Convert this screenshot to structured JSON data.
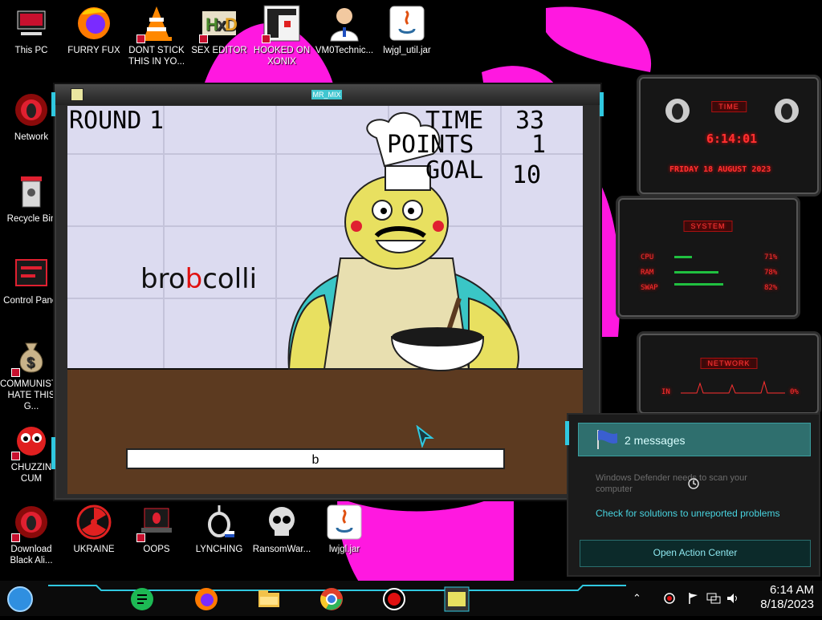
{
  "desktop": {
    "icons_top": [
      {
        "label": "This PC",
        "icon": "this-pc-icon"
      },
      {
        "label": "FURRY FUX",
        "icon": "firefox-icon"
      },
      {
        "label": "DONT STICK THIS IN YO...",
        "icon": "vlc-cone-icon"
      },
      {
        "label": "SEX EDITOR",
        "icon": "hxd-editor-icon"
      },
      {
        "label": "HOOKED ON XONIX",
        "icon": "xonix-game-icon"
      },
      {
        "label": "VM0Technic...",
        "icon": "doctor-avatar-icon"
      },
      {
        "label": "lwjgl_util.jar",
        "icon": "java-jar-icon"
      }
    ],
    "icons_left": [
      {
        "label": "Network",
        "icon": "network-alien-icon"
      },
      {
        "label": "Recycle Bin",
        "icon": "recycle-bin-icon"
      },
      {
        "label": "Control Panel",
        "icon": "control-panel-icon"
      },
      {
        "label": "COMMUNISTS HATE THIS G...",
        "icon": "money-bag-icon"
      },
      {
        "label": "CHUZZIN CUM",
        "icon": "chuzzle-icon"
      }
    ],
    "icons_bottom": [
      {
        "label": "Download Black Ali...",
        "icon": "alien-download-icon"
      },
      {
        "label": "UKRAINE",
        "icon": "radiation-icon"
      },
      {
        "label": "OOPS",
        "icon": "laptop-alien-icon"
      },
      {
        "label": "LYNCHING",
        "icon": "noose-icon"
      },
      {
        "label": "RansomWar...",
        "icon": "skull-icon"
      },
      {
        "label": "lwjgl.jar",
        "icon": "java-jar-icon"
      }
    ]
  },
  "game_window": {
    "title": "MR_MIX",
    "hud": {
      "round_label": "ROUND",
      "round_value": "1",
      "time_label": "TIME",
      "time_value": "33",
      "points_label": "POINTS",
      "points_value": "1",
      "goal_label": "GOAL",
      "goal_value": "10"
    },
    "word": {
      "typed": "bro",
      "cursor": "b",
      "rest": "colli"
    },
    "input_value": "b"
  },
  "gadgets": {
    "time": {
      "title": "TIME",
      "clock": "6:14:01",
      "date": "FRIDAY 18 AUGUST 2023"
    },
    "system": {
      "title": "SYSTEM",
      "rows": [
        {
          "label": "CPU",
          "value": "71%",
          "fraction": 0.2
        },
        {
          "label": "RAM",
          "value": "78%",
          "fraction": 0.5
        },
        {
          "label": "SWAP",
          "value": "82%",
          "fraction": 0.55
        }
      ]
    },
    "network": {
      "title": "NETWORK",
      "in_label": "IN",
      "in_value": "0%"
    }
  },
  "action_center": {
    "message_count": "2 messages",
    "faded_text": "Windows Defender needs to scan your computer",
    "link_text": "Check for solutions to unreported problems",
    "open_label": "Open Action Center"
  },
  "taskbar": {
    "apps": [
      "start-orb-icon",
      "notes-app-icon",
      "firefox-icon",
      "file-explorer-icon",
      "chrome-icon",
      "record-icon",
      "game-app-icon"
    ],
    "time": "6:14 AM",
    "date": "8/18/2023"
  },
  "colors": {
    "accent_cyan": "#30c8e0",
    "alien_red": "#ff3030",
    "wall_pink": "#ff18e0"
  }
}
